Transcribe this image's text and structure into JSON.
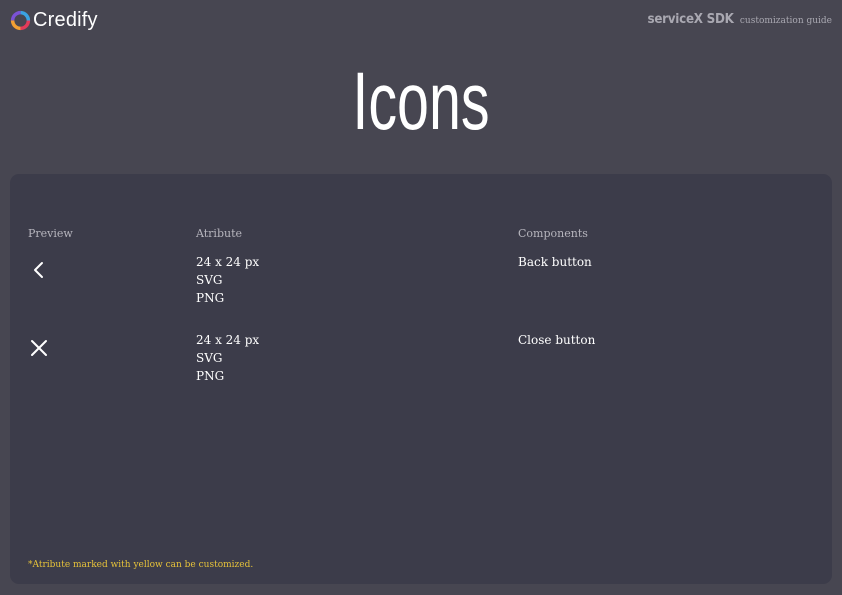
{
  "brand": {
    "name": "Credify",
    "logo_colors": [
      "#e23a5a",
      "#f2a033",
      "#7b52d6",
      "#3aa3e2"
    ]
  },
  "header": {
    "title": "serviceX SDK",
    "subtitle": "customization guide"
  },
  "page": {
    "title": "Icons"
  },
  "table": {
    "columns": {
      "preview": "Preview",
      "attribute": "Atribute",
      "components": "Components"
    },
    "rows": [
      {
        "icon": "chevron-left-icon",
        "attributes": [
          "24 x 24 px",
          "SVG",
          "PNG"
        ],
        "component": "Back button"
      },
      {
        "icon": "close-icon",
        "attributes": [
          "24 x 24 px",
          "SVG",
          "PNG"
        ],
        "component": "Close button"
      }
    ]
  },
  "footnote": "*Atribute marked with yellow can be customized.",
  "colors": {
    "background": "#474651",
    "card": "#3c3c4a",
    "highlight": "#e6c23a"
  }
}
